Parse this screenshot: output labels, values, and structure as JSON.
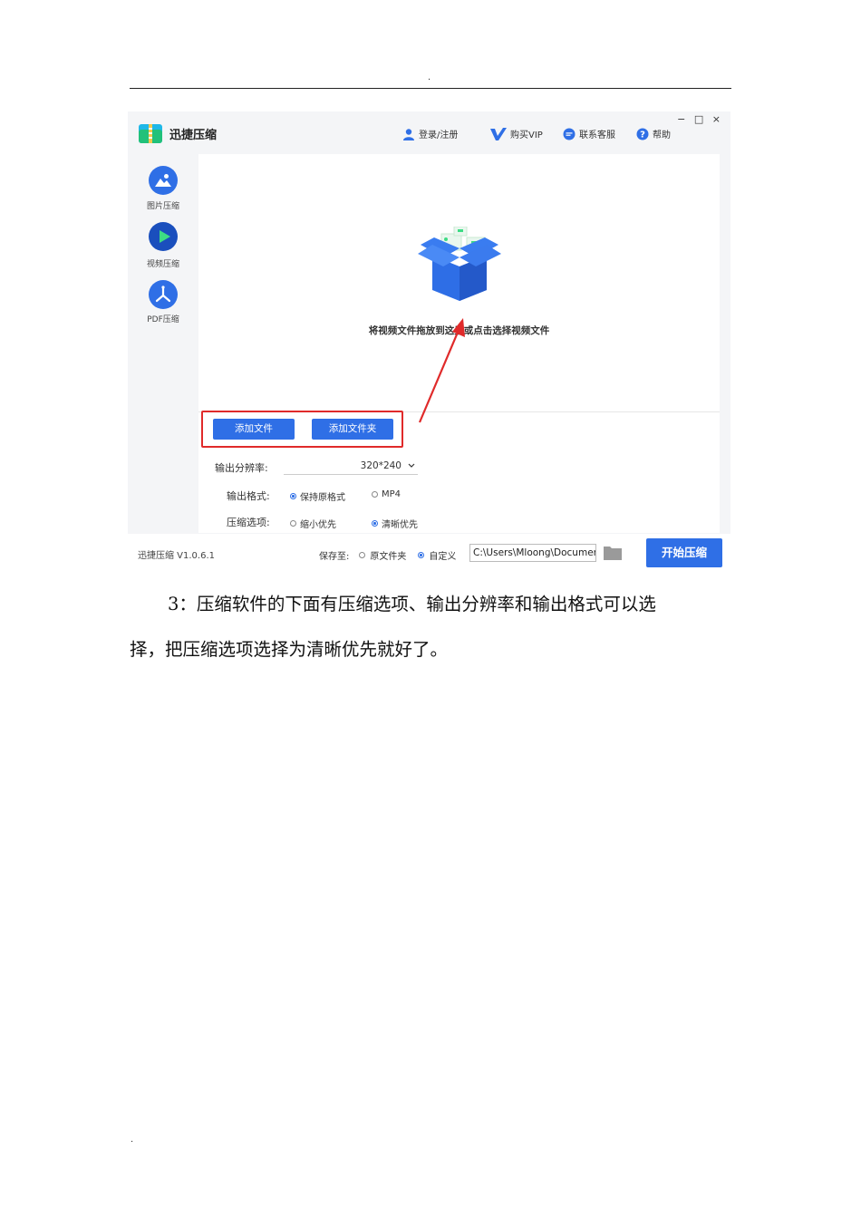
{
  "page": {
    "header_mark": ".",
    "footer_mark": "."
  },
  "app": {
    "title": "迅捷压缩",
    "nav": {
      "login": "登录/注册",
      "vip": "购买VIP",
      "service": "联系客服",
      "help": "帮助"
    },
    "window_controls": "− □ ×",
    "sidebar": [
      {
        "label": "图片压缩",
        "icon": "image-icon"
      },
      {
        "label": "视频压缩",
        "icon": "play-icon"
      },
      {
        "label": "PDF压缩",
        "icon": "pdf-icon"
      }
    ],
    "drop_zone_text": "将视频文件拖放到这里或点击选择视频文件",
    "buttons": {
      "add_file": "添加文件",
      "add_folder": "添加文件夹",
      "start": "开始压缩"
    },
    "options": {
      "resolution_label": "输出分辨率:",
      "resolution_value": "320*240",
      "format_label": "输出格式:",
      "format_options": [
        "保持原格式",
        "MP4"
      ],
      "format_selected": 0,
      "compress_label": "压缩选项:",
      "compress_options": [
        "缩小优先",
        "清晰优先"
      ],
      "compress_selected": 1
    },
    "status": {
      "version": "迅捷压缩 V1.0.6.1",
      "save_to_label": "保存至:",
      "save_options": [
        "原文件夹",
        "自定义"
      ],
      "save_selected": 1,
      "path": "C:\\Users\\Mloong\\Documents"
    },
    "colors": {
      "accent": "#2f6fe6",
      "highlight": "#e02a2a"
    }
  },
  "body": {
    "line1": "3：压缩软件的下面有压缩选项、输出分辨率和输出格式可以选",
    "line2": "择，把压缩选项选择为清晰优先就好了。"
  }
}
